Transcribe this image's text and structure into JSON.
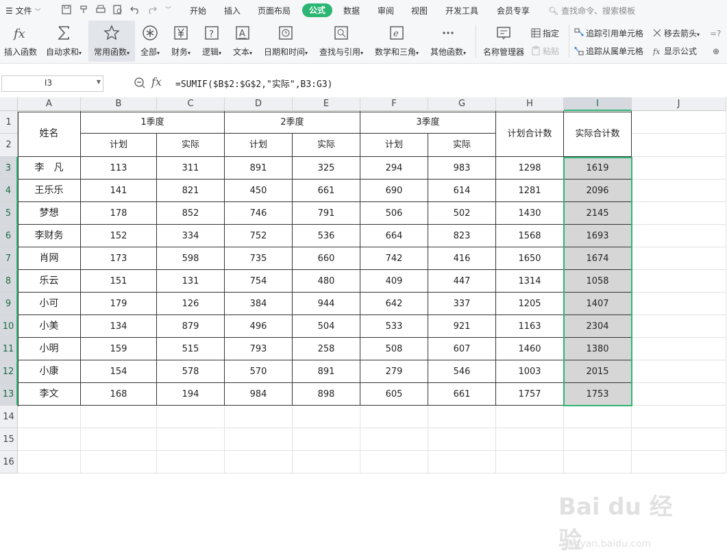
{
  "menu": {
    "file_label": "文件",
    "tabs": [
      "开始",
      "插入",
      "页面布局",
      "公式",
      "数据",
      "审阅",
      "视图",
      "开发工具",
      "会员专享"
    ],
    "active_tab": "公式",
    "search_placeholder": "查找命令、搜索模板"
  },
  "ribbon": {
    "buttons": [
      "插入函数",
      "自动求和",
      "常用函数",
      "全部",
      "财务",
      "逻辑",
      "文本",
      "日期和时间",
      "查找与引用",
      "数学和三角",
      "其他函数",
      "名称管理器"
    ],
    "selected": "常用函数",
    "small": {
      "specify": "指定",
      "paste": "粘贴",
      "trace_precedents": "追踪引用单元格",
      "trace_dependents": "追踪从属单元格",
      "remove_arrows": "移去箭头",
      "show_formulas": "显示公式"
    }
  },
  "formula_bar": {
    "name_box": "I3",
    "formula": "=SUMIF($B$2:$G$2,\"实际\",B3:G3)"
  },
  "sheet": {
    "columns": [
      "A",
      "B",
      "C",
      "D",
      "E",
      "F",
      "G",
      "H",
      "I",
      "J"
    ],
    "rows": [
      "1",
      "2",
      "3",
      "4",
      "5",
      "6",
      "7",
      "8",
      "9",
      "10",
      "11",
      "12",
      "13",
      "14",
      "15",
      "16"
    ],
    "selected_column": "I",
    "header": {
      "name": "姓名",
      "q1": "1季度",
      "q2": "2季度",
      "q3": "3季度",
      "plan_total": "计划合计数",
      "actual_total": "实际合计数",
      "plan": "计划",
      "actual": "实际"
    },
    "data": [
      [
        "李　凡",
        "113",
        "311",
        "891",
        "325",
        "294",
        "983",
        "1298",
        "1619"
      ],
      [
        "王乐乐",
        "141",
        "821",
        "450",
        "661",
        "690",
        "614",
        "1281",
        "2096"
      ],
      [
        "梦想",
        "178",
        "852",
        "746",
        "791",
        "506",
        "502",
        "1430",
        "2145"
      ],
      [
        "李财务",
        "152",
        "334",
        "752",
        "536",
        "664",
        "823",
        "1568",
        "1693"
      ],
      [
        "肖网",
        "173",
        "598",
        "735",
        "660",
        "742",
        "416",
        "1650",
        "1674"
      ],
      [
        "乐云",
        "151",
        "131",
        "754",
        "480",
        "409",
        "447",
        "1314",
        "1058"
      ],
      [
        "小可",
        "179",
        "126",
        "384",
        "944",
        "642",
        "337",
        "1205",
        "1407"
      ],
      [
        "小美",
        "134",
        "879",
        "496",
        "504",
        "533",
        "921",
        "1163",
        "2304"
      ],
      [
        "小明",
        "159",
        "515",
        "793",
        "258",
        "508",
        "607",
        "1460",
        "1380"
      ],
      [
        "小康",
        "154",
        "578",
        "570",
        "891",
        "279",
        "546",
        "1003",
        "2015"
      ],
      [
        "李文",
        "168",
        "194",
        "984",
        "898",
        "605",
        "661",
        "1757",
        "1753"
      ]
    ]
  },
  "watermark": {
    "brand": "Bai du 经验",
    "url": "jingyan.baidu.com"
  }
}
